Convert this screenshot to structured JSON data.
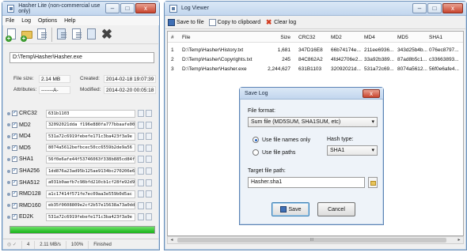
{
  "hasher": {
    "title": "Hasher Lite (non-commercial use only)",
    "menu": [
      "File",
      "Log",
      "Options",
      "Help"
    ],
    "path": "D:\\Temp\\Hasher\\Hasher.exe",
    "info": {
      "file_size_label": "File size:",
      "file_size": "2.14 MB",
      "created_label": "Created:",
      "created": "2014-02-18 19:07:39",
      "attributes_label": "Attributes:",
      "attributes": "-------A-",
      "modified_label": "Modified:",
      "modified": "2014-02-20 00:05:18"
    },
    "hashes": [
      {
        "name": "CRC32",
        "value": "631b1103"
      },
      {
        "name": "MD2",
        "value": "32092021dda f196e880fa777bbaafe00"
      },
      {
        "name": "MD4",
        "value": "531a72c6919febefe171c3ba423f3a9e"
      },
      {
        "name": "MD5",
        "value": "8074a5612befbcec50cc6559b2de9a56"
      },
      {
        "name": "SHA1",
        "value": "56f0e6afe44f53746063f338b885cd84f5"
      },
      {
        "name": "SHA256",
        "value": "1dd876a23ad95b125ae9134bc270206e68"
      },
      {
        "name": "SHA512",
        "value": "a031b0aefb7c98bfd210cb1cf28fe92d97"
      },
      {
        "name": "RMD128",
        "value": "a1c17414f571fe7ec09aa3e559b0d5ac"
      },
      {
        "name": "RMD160",
        "value": "eb35f0608809e2cf2b57e15638a73a0dd1"
      },
      {
        "name": "ED2K",
        "value": "531a72c6919febefe171c3ba423f3a9e"
      }
    ],
    "progress_fraction": 1.0,
    "status": {
      "count": "4",
      "speed": "2.11 MB/s",
      "percent": "100%",
      "state": "Finished"
    }
  },
  "log_viewer": {
    "title": "Log Viewer",
    "toolbar": {
      "save": "Save to file",
      "copy": "Copy to clipboard",
      "clear": "Clear log"
    },
    "columns": [
      "#",
      "File",
      "Size",
      "CRC32",
      "MD2",
      "MD4",
      "MD5",
      "SHA1"
    ],
    "rows": [
      [
        "1",
        "D:\\Temp\\Hasher\\History.txt",
        "1,681",
        "347D16E8",
        "66b74174e...",
        "211ee6936...",
        "343d25b4b...",
        "076ec8797..."
      ],
      [
        "2",
        "D:\\Temp\\Hasher\\Copyrights.txt",
        "245",
        "84C862A2",
        "4fd42706e2...",
        "33a92b389...",
        "87ad8b5c1...",
        "c33663893..."
      ],
      [
        "3",
        "D:\\Temp\\Hasher\\Hasher.exe",
        "2,244,627",
        "631B1103",
        "32092021d...",
        "531a72c69...",
        "8074a5612...",
        "56f0e6afe4..."
      ]
    ],
    "scroll_label": "III"
  },
  "save_dialog": {
    "title": "Save Log",
    "file_format_label": "File format:",
    "file_format": "Sum file (MD5SUM, SHA1SUM, etc)",
    "radio_names": "Use file names only",
    "radio_paths": "Use file paths",
    "hash_type_label": "Hash type:",
    "hash_type": "SHA1",
    "target_label": "Target file path:",
    "target": "Hasher.sha1",
    "save": "Save",
    "cancel": "Cancel"
  }
}
